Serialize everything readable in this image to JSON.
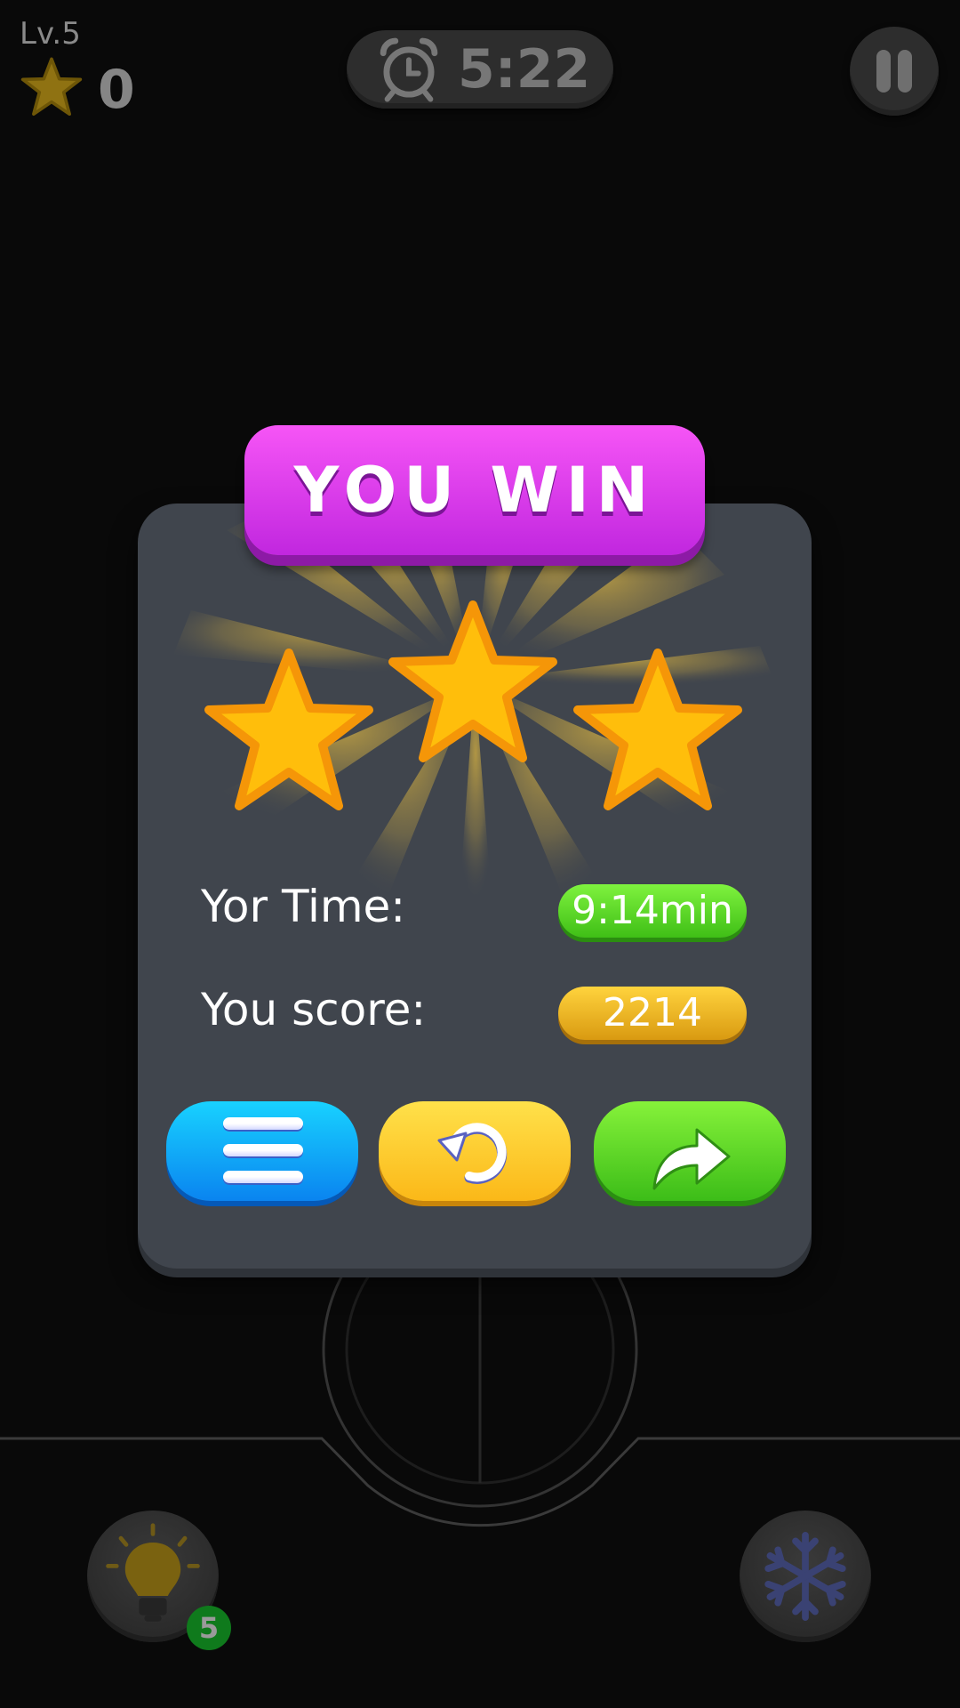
{
  "hud": {
    "level": "Lv.5",
    "stars": "0",
    "timer": "5:22",
    "timer_icon": "alarm-clock-icon",
    "pause_icon": "pause-icon"
  },
  "dialog": {
    "title": "YOU WIN",
    "stars_earned": 3,
    "stars_total": 3,
    "time_label": "Yor Time:",
    "time_value": "9:14min",
    "score_label": "You score:",
    "score_value": "2214",
    "buttons": [
      {
        "name": "menu-button",
        "icon": "menu-icon",
        "color": "#0a9cf5"
      },
      {
        "name": "replay-button",
        "icon": "replay-icon",
        "color": "#fbc21e"
      },
      {
        "name": "next-button",
        "icon": "next-arrow-icon",
        "color": "#4fd020"
      }
    ]
  },
  "boosters": {
    "hint_icon": "lightbulb-icon",
    "hint_count": "5",
    "freeze_icon": "snowflake-icon"
  },
  "colors": {
    "banner": "#d63ae8",
    "panel": "#40454d",
    "star": "#ffbe0b",
    "time_pill": "#5ad426",
    "score_pill": "#e9b020"
  }
}
